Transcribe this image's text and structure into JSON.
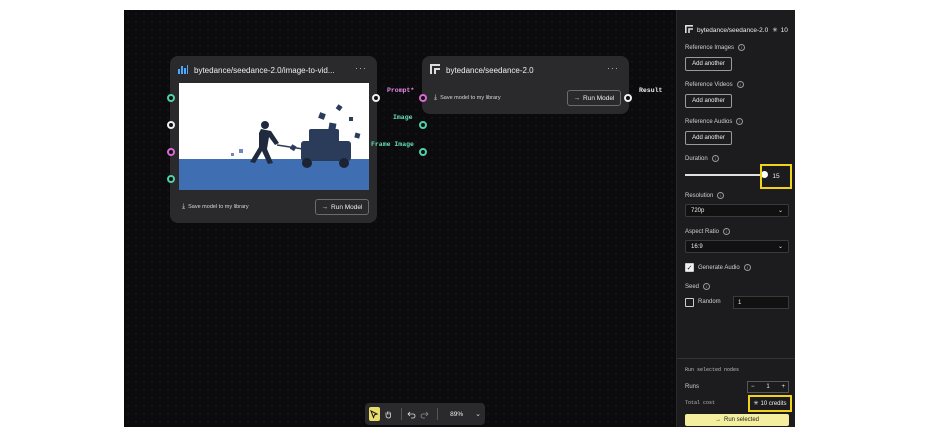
{
  "nodes": {
    "image_node": {
      "title": "bytedance/seedance-2.0/image-to-vid...",
      "save_label": "Save model to my library",
      "run_label": "Run Model"
    },
    "model_node": {
      "title": "bytedance/seedance-2.0",
      "save_label": "Save model to my library",
      "run_label": "Run Model"
    },
    "ports": {
      "prompt": "Prompt*",
      "image": "Image",
      "frame_image": "Frame Image",
      "result": "Result"
    },
    "menu_glyph": "···",
    "run_arrow": "→"
  },
  "toolbar": {
    "zoom": "89%"
  },
  "panel": {
    "model_name": "bytedance/seedance-2.0",
    "header_credits": "10",
    "reference_images_label": "Reference Images",
    "reference_videos_label": "Reference Videos",
    "reference_audios_label": "Reference Audios",
    "add_another": "Add another",
    "duration_label": "Duration",
    "duration_value": "15",
    "resolution_label": "Resolution",
    "resolution_value": "720p",
    "aspect_ratio_label": "Aspect Ratio",
    "aspect_ratio_value": "16:9",
    "generate_audio_label": "Generate Audio",
    "generate_audio_checked": true,
    "seed_label": "Seed",
    "random_label": "Random",
    "random_checked": false,
    "seed_value": "1",
    "run_selected_nodes_label": "Run selected nodes",
    "runs_label": "Runs",
    "runs_value": "1",
    "total_cost_label": "Total cost",
    "total_cost_value": "10 credits",
    "run_selected_button": "Run selected"
  },
  "colors": {
    "highlight": "#f2d21b",
    "port_green": "#4fd1a5",
    "port_pink": "#d86ad6",
    "run_button_bg": "#f4ef9e"
  }
}
